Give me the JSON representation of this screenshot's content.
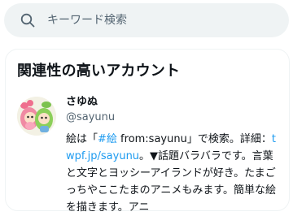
{
  "search": {
    "placeholder": "キーワード検索",
    "icon": "search-icon"
  },
  "related": {
    "title": "関連性の高いアカウント",
    "account": {
      "name": "さゆぬ",
      "handle": "@sayunu",
      "bio": {
        "part1": "絵は「",
        "hashtag": "#絵",
        "part2": " from:sayunu」で検索。詳細：",
        "link": "twpf.jp/sayunu",
        "part3": "。▼話題バラバラです。言葉と文字とヨッシーアイランドが好き。たまごっちやここたまのアニメもみます。簡単な絵を描きます。アニ"
      }
    }
  },
  "colors": {
    "accent": "#1d9bf0",
    "search_bg": "#eff3f4",
    "secondary_text": "#536471"
  }
}
